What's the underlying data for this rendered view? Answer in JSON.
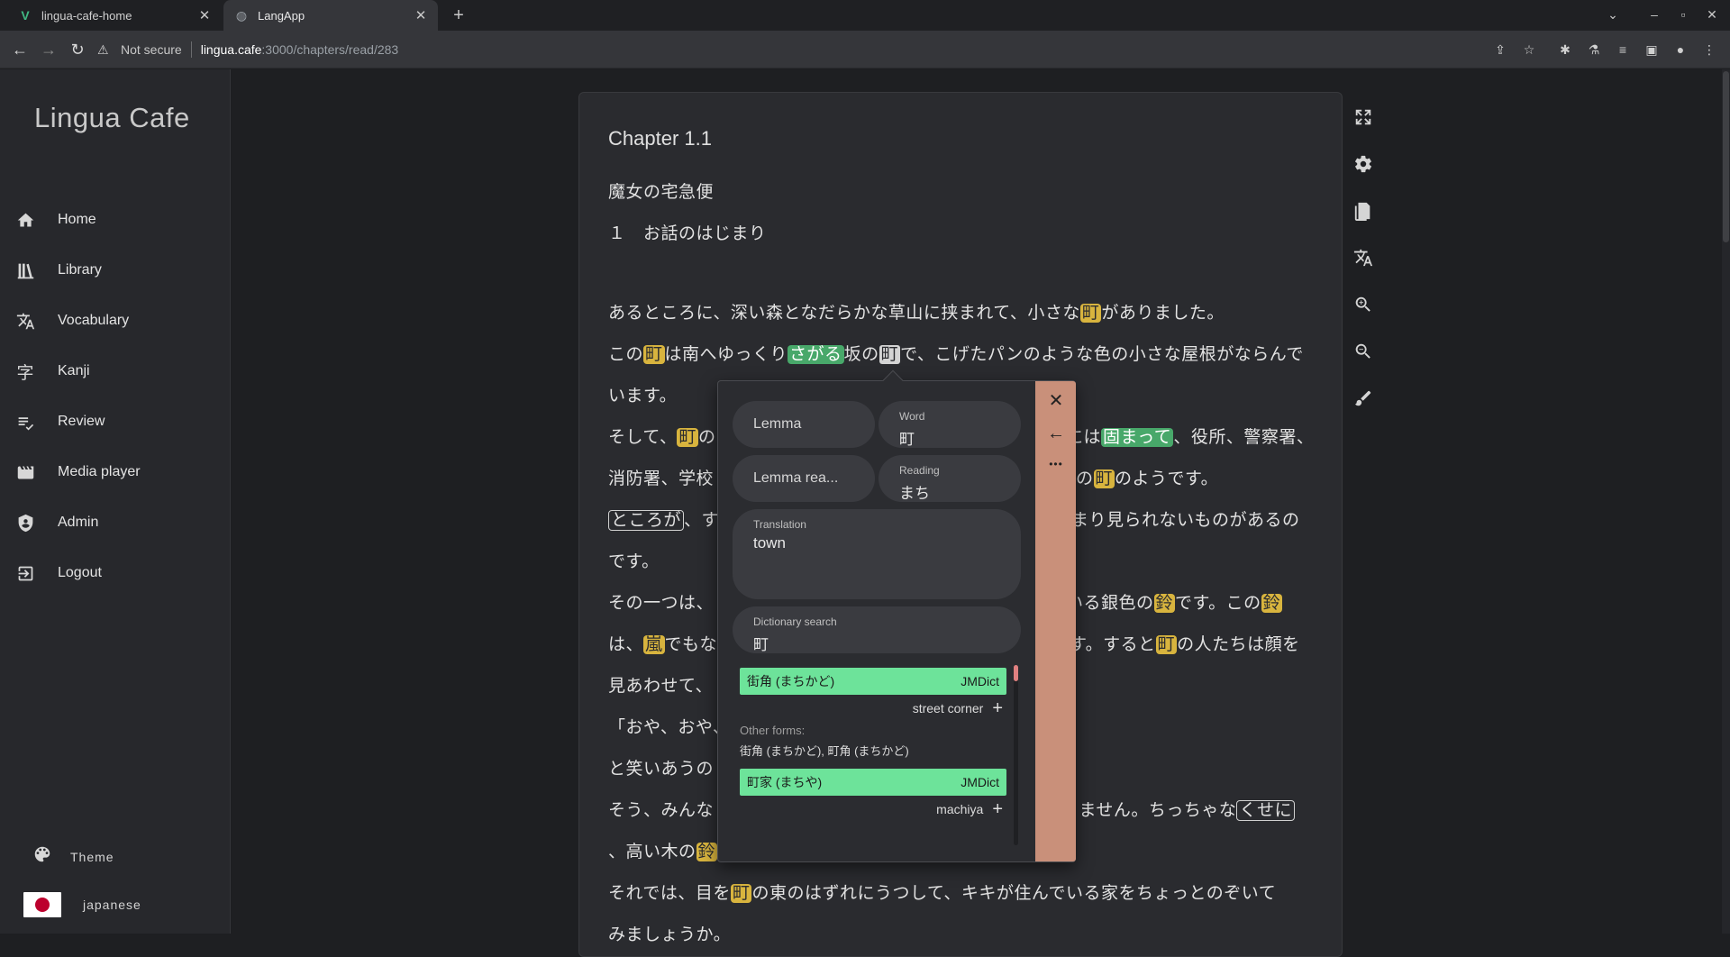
{
  "browser": {
    "tabs": [
      {
        "title": "lingua-cafe-home",
        "active": false,
        "favicon": "vue-logo-icon"
      },
      {
        "title": "LangApp",
        "active": true,
        "favicon": "globe-icon"
      }
    ],
    "security": "Not secure",
    "url_host": "lingua.cafe",
    "url_path": ":3000/chapters/read/283"
  },
  "sidebar": {
    "logo": "Lingua Cafe",
    "items": [
      {
        "label": "Home",
        "icon": "home-icon"
      },
      {
        "label": "Library",
        "icon": "library-icon"
      },
      {
        "label": "Vocabulary",
        "icon": "translate-icon"
      },
      {
        "label": "Kanji",
        "icon": "kanji-icon"
      },
      {
        "label": "Review",
        "icon": "review-icon"
      },
      {
        "label": "Media player",
        "icon": "media-player-icon"
      },
      {
        "label": "Admin",
        "icon": "shield-icon"
      },
      {
        "label": "Logout",
        "icon": "logout-icon"
      }
    ],
    "theme_label": "Theme",
    "language_label": "japanese"
  },
  "reader": {
    "chapter_title": "Chapter 1.1",
    "book_title": "魔女の宅急便",
    "section_title": "１　お話のはじまり",
    "lines": {
      "l1a": "あるところに、深い森となだらかな草山に挟まれて、小さな",
      "l1w": "町",
      "l1b": "がありました。",
      "l2a": "この",
      "l2w1": "町",
      "l2b": "は南へゆっくり",
      "l2w2": "さがる",
      "l2c": "坂の",
      "l2w3": "町",
      "l2d": "で、こげたパンのような色の小さな屋根がならんで",
      "l3": "います。",
      "l4a": "そして、",
      "l4w1": "町",
      "l4b": "の",
      "l4c": "には",
      "l4w2": "固まって",
      "l4d": "、役所、警察署、",
      "l5a": "消防署、学校",
      "l5b": "の",
      "l5w": "町",
      "l5c": "のようです。",
      "l6w": "ところが",
      "l6a": "、す",
      "l6b": "まり見られないものがあるの",
      "l7": "です。",
      "l8a": "その一つは、",
      "l8b": "いる銀色の",
      "l8w1": "鈴",
      "l8c": "です。この",
      "l8w2": "鈴",
      "l9a": "は、",
      "l9w1": "嵐",
      "l9b": "でもな",
      "l9c": "す。すると",
      "l9w2": "町",
      "l9d": "の人たちは顔を",
      "l10": "見あわせて、",
      "l11": "「おや、おや、",
      "l12": "と笑いあうの",
      "l13a": "そう、みんな",
      "l13b": "りません。ちっちゃな",
      "l13w": "くせに",
      "l14a": "、高い木の",
      "l14w": "鈴",
      "l15a": "それでは、目を",
      "l15w": "町",
      "l15b": "の東のはずれにうつして、キキが住んでいる家をちょっとのぞいて",
      "l16": "みましょうか。"
    }
  },
  "popup": {
    "lemma_placeholder": "Lemma",
    "word_label": "Word",
    "word_value": "町",
    "lemma_reading_placeholder": "Lemma rea...",
    "reading_label": "Reading",
    "reading_value": "まち",
    "translation_label": "Translation",
    "translation_value": "town",
    "dict_search_label": "Dictionary search",
    "dict_search_value": "町",
    "results": [
      {
        "term": "街角 (まちかど)",
        "source": "JMDict",
        "definition": "street corner"
      },
      {
        "term": "町家 (まちや)",
        "source": "JMDict",
        "definition": "machiya"
      }
    ],
    "other_forms_label": "Other forms:",
    "other_forms_value": "街角 (まちかど), 町角 (まちかど)",
    "side_close": "✕",
    "side_back": "←",
    "side_more": "•••"
  },
  "colors": {
    "known_word": "#d8b43e",
    "learning_word": "#48a86a",
    "popup_side": "#c9907a",
    "dict_result": "#6de39a"
  }
}
